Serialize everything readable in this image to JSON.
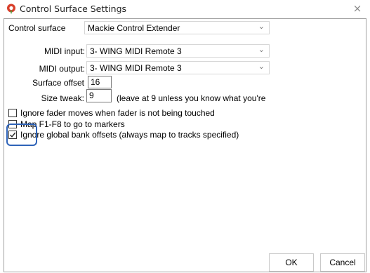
{
  "window": {
    "title": "Control Surface Settings",
    "close_glyph": "×",
    "icon": "reaper-logo-icon"
  },
  "form": {
    "control_surface_label": "Control surface",
    "control_surface_value": "Mackie Control Extender",
    "midi_input_label": "MIDI input:",
    "midi_input_value": "3- WING MIDI Remote 3",
    "midi_output_label": "MIDI output:",
    "midi_output_value": "3- WING MIDI Remote 3",
    "surface_offset_label": "Surface offset",
    "surface_offset_value": "16",
    "size_tweak_label": "Size tweak:",
    "size_tweak_value": "9",
    "size_tweak_hint": "(leave at 9 unless you know what you're"
  },
  "options": [
    {
      "label": "Ignore fader moves when fader is not being touched",
      "checked": false
    },
    {
      "label": "Map F1-F8 to go to markers",
      "checked": false
    },
    {
      "label": "Ignore global bank offsets (always map to tracks specified)",
      "checked": true
    }
  ],
  "buttons": {
    "ok": "OK",
    "cancel": "Cancel"
  },
  "colors": {
    "highlight": "#2e63b8",
    "logo_red": "#d9402c",
    "logo_green": "#4e9a3b"
  }
}
